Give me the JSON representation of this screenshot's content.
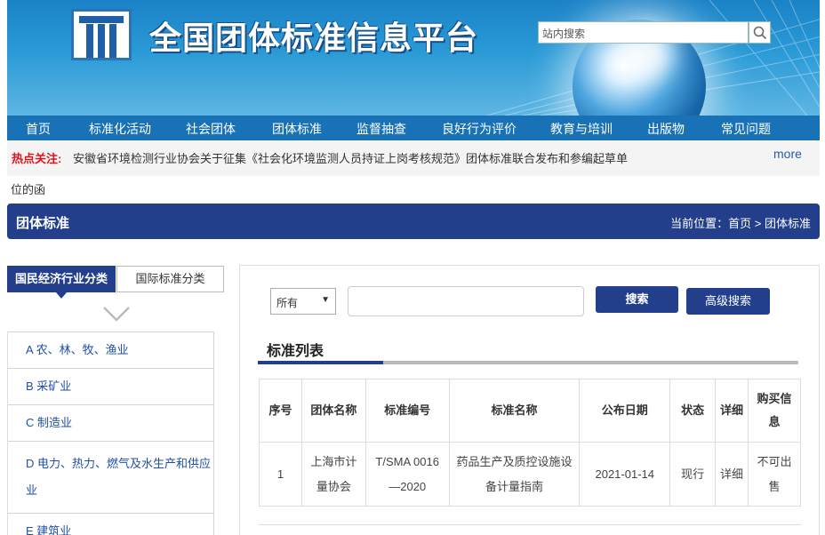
{
  "header": {
    "site_title": "全国团体标准信息平台",
    "search_placeholder": "站内搜索",
    "search_icon": "search-icon",
    "logo_icon": "platform-logo"
  },
  "nav": {
    "items": [
      "首页",
      "标准化活动",
      "社会团体",
      "团体标准",
      "监督抽查",
      "良好行为评价",
      "教育与培训",
      "出版物",
      "常见问题"
    ]
  },
  "hot": {
    "label": "热点关注:",
    "text": "安徽省环境检测行业协会关于征集《社会化环境监测人员持证上岗考核规范》团体标准联合发布和参编起草单",
    "continuation": "位的函",
    "more": "more"
  },
  "section": {
    "title": "团体标准",
    "breadcrumb": "当前位置：首页 > 团体标准"
  },
  "left": {
    "tab_active": "国民经济行业分类",
    "tab_inactive": "国际标准分类",
    "categories": [
      "A 农、林、牧、渔业",
      "B 采矿业",
      "C 制造业",
      "D 电力、热力、燃气及水生产和供应",
      "业",
      "E 建筑业"
    ]
  },
  "main": {
    "select_value": "所有",
    "search_button": "搜索",
    "advanced_button": "高级搜索",
    "list_title": "标准列表",
    "table": {
      "headers": [
        "序号",
        "团体名称",
        "标准编号",
        "标准名称",
        "公布日期",
        "状态",
        "详细",
        "购买信",
        "息"
      ],
      "row": {
        "index": "1",
        "org_line1": "上海市计",
        "org_line2": "量协会",
        "code_line1": "T/SMA 0016",
        "code_line2": "—2020",
        "name_line1": "药品生产及质控设施设",
        "name_line2": "备计量指南",
        "date": "2021-01-14",
        "status": "现行",
        "detail": "详细",
        "buy_line1": "不可出",
        "buy_line2": "售"
      }
    }
  },
  "colors": {
    "nav_blue": "#1a72b6",
    "title_navy": "#233f8c",
    "hot_red": "#e0141e",
    "link_purple": "#7a2c8e"
  }
}
